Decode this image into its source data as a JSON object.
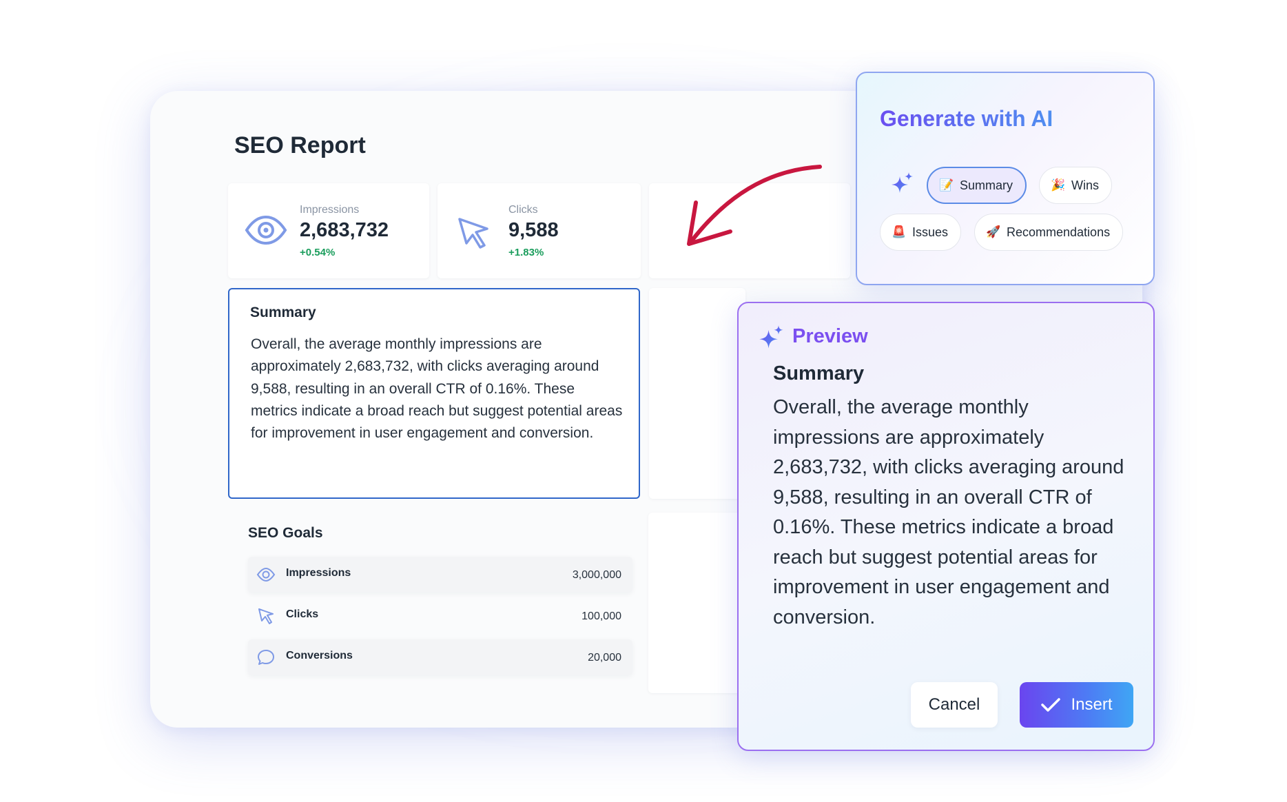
{
  "report": {
    "title": "SEO Report",
    "metrics": [
      {
        "label": "Impressions",
        "value": "2,683,732",
        "delta": "+0.54%",
        "icon": "eye-icon"
      },
      {
        "label": "Clicks",
        "value": "9,588",
        "delta": "+1.83%",
        "icon": "cursor-icon"
      }
    ],
    "summary": {
      "heading": "Summary",
      "text": "Overall, the average monthly impressions are approximately 2,683,732, with clicks averaging around 9,588, resulting in an overall CTR of 0.16%. These metrics indicate a broad reach but suggest potential areas for improvement in user engagement and conversion."
    },
    "goals": {
      "title": "SEO Goals",
      "rows": [
        {
          "name": "Impressions",
          "value": "3,000,000",
          "icon": "eye-icon"
        },
        {
          "name": "Clicks",
          "value": "100,000",
          "icon": "cursor-icon"
        },
        {
          "name": "Conversions",
          "value": "20,000",
          "icon": "chat-bubble-icon"
        }
      ]
    }
  },
  "ai_panel": {
    "title": "Generate with AI",
    "chips": [
      {
        "label": "Summary",
        "emoji": "📝",
        "active": true
      },
      {
        "label": "Wins",
        "emoji": "🎉",
        "active": false
      },
      {
        "label": "Issues",
        "emoji": "🚨",
        "active": false
      },
      {
        "label": "Recommendations",
        "emoji": "🚀",
        "active": false
      }
    ]
  },
  "preview": {
    "title": "Preview",
    "heading": "Summary",
    "text": "Overall, the average monthly impressions are approximately 2,683,732, with clicks averaging around 9,588, resulting in an overall CTR of 0.16%. These metrics indicate a broad reach but suggest potential areas for improvement in user engagement and conversion.",
    "cancel_label": "Cancel",
    "insert_label": "Insert"
  },
  "colors": {
    "accent_purple": "#7b4ff0",
    "accent_blue": "#2f66c9",
    "positive_green": "#1a9d5c",
    "arrow_red": "#c8173f"
  }
}
